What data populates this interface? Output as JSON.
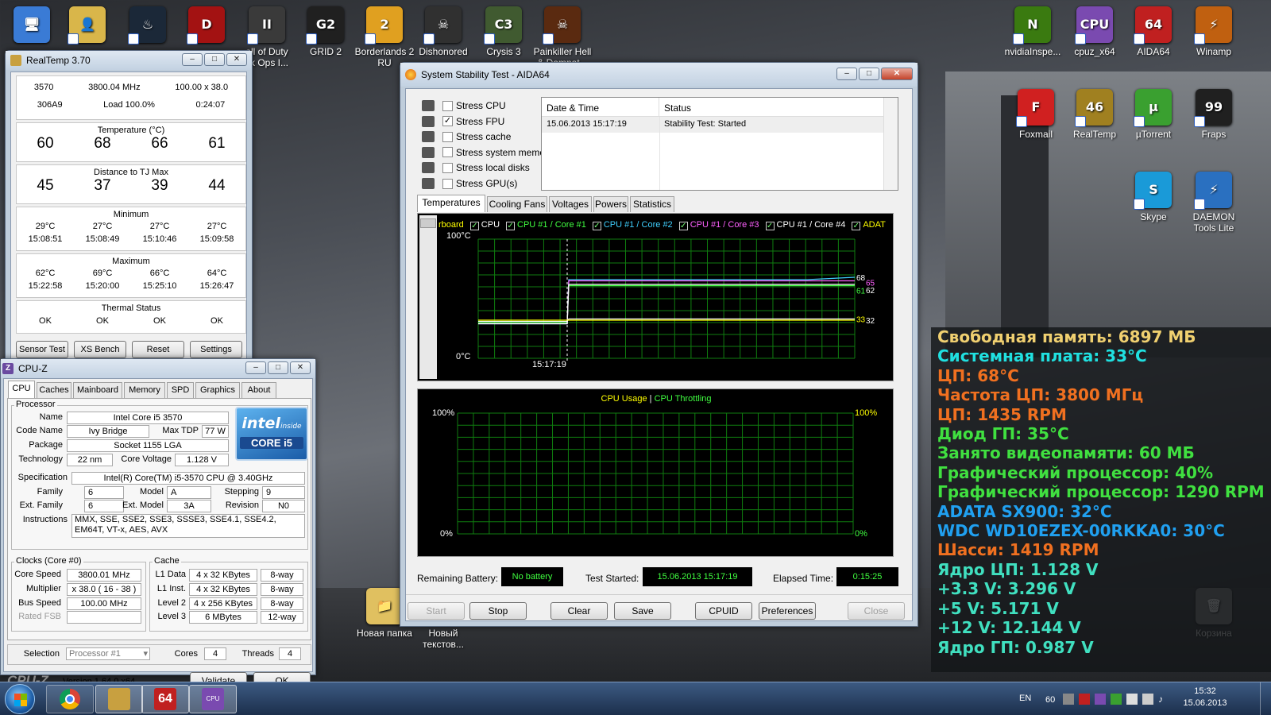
{
  "desktop": {
    "icons": [
      {
        "label": "",
        "color": "#3a7bd5",
        "glyph": "🖥"
      },
      {
        "label": "",
        "color": "#d9b64a",
        "glyph": "👤"
      },
      {
        "label": "",
        "color": "#1b2838",
        "glyph": "♨"
      },
      {
        "label": "",
        "color": "#a31212",
        "glyph": "D"
      },
      {
        "label": "all of Duty",
        "label2": "ck Ops I...",
        "color": "#3a3a3a",
        "glyph": "II"
      },
      {
        "label": "GRID 2",
        "color": "#202020",
        "glyph": "G2"
      },
      {
        "label": "Borderlands 2",
        "label2": "RU",
        "color": "#e0a020",
        "glyph": "2"
      },
      {
        "label": "Dishonored",
        "color": "#303030",
        "glyph": "☠"
      },
      {
        "label": "Crysis 3",
        "color": "#405a30",
        "glyph": "C3"
      },
      {
        "label": "Painkiller Hell",
        "label2": "& Damnat...",
        "color": "#5a2a10",
        "glyph": "☠"
      },
      {
        "label": "nvidiaInspe...",
        "color": "#3a7a10",
        "glyph": "N"
      },
      {
        "label": "cpuz_x64",
        "color": "#7a4ab0",
        "glyph": "CPU"
      },
      {
        "label": "AIDA64",
        "color": "#c02020",
        "glyph": "64"
      },
      {
        "label": "Winamp",
        "color": "#c06010",
        "glyph": "⚡"
      },
      {
        "label": "Foxmail",
        "color": "#d02020",
        "glyph": "F"
      },
      {
        "label": "RealTemp",
        "color": "#a08020",
        "glyph": "46"
      },
      {
        "label": "µTorrent",
        "color": "#3aa030",
        "glyph": "µ"
      },
      {
        "label": "Fraps",
        "color": "#202020",
        "glyph": "99"
      },
      {
        "label": "Skype",
        "color": "#1a9ad8",
        "glyph": "S"
      },
      {
        "label": "DAEMON",
        "label2": "Tools Lite",
        "color": "#2a70c0",
        "glyph": "⚡"
      },
      {
        "label": "Новая папка",
        "color": "#e0c060",
        "glyph": "📁"
      },
      {
        "label": "Новый",
        "label2": "текстов...",
        "color": "#d0d0d0",
        "glyph": "📄"
      },
      {
        "label": "Корзина",
        "color": "#8a8a8a",
        "glyph": "🗑"
      }
    ]
  },
  "realtemp": {
    "title": "RealTemp 3.70",
    "info": [
      "3570",
      "3800.04 MHz",
      "100.00 x 38.0",
      "306A9",
      "Load 100.0%",
      "0:24:07"
    ],
    "temp_label": "Temperature (°C)",
    "temps": [
      "60",
      "68",
      "66",
      "61"
    ],
    "dist_label": "Distance to TJ Max",
    "dists": [
      "45",
      "37",
      "39",
      "44"
    ],
    "min_label": "Minimum",
    "min_vals": [
      "29°C",
      "27°C",
      "27°C",
      "27°C"
    ],
    "min_times": [
      "15:08:51",
      "15:08:49",
      "15:10:46",
      "15:09:58"
    ],
    "max_label": "Maximum",
    "max_vals": [
      "62°C",
      "69°C",
      "66°C",
      "64°C"
    ],
    "max_times": [
      "15:22:58",
      "15:20:00",
      "15:25:10",
      "15:26:47"
    ],
    "thermal_label": "Thermal Status",
    "thermal": [
      "OK",
      "OK",
      "OK",
      "OK"
    ],
    "buttons": [
      "Sensor Test",
      "XS Bench",
      "Reset",
      "Settings"
    ]
  },
  "cpuz": {
    "title": "CPU-Z",
    "tabs": [
      "CPU",
      "Caches",
      "Mainboard",
      "Memory",
      "SPD",
      "Graphics",
      "About"
    ],
    "processor_label": "Processor",
    "name_l": "Name",
    "name": "Intel Core i5 3570",
    "codename_l": "Code Name",
    "codename": "Ivy Bridge",
    "tdp_l": "Max TDP",
    "tdp": "77 W",
    "package_l": "Package",
    "package": "Socket 1155 LGA",
    "tech_l": "Technology",
    "tech": "22 nm",
    "voltage_l": "Core Voltage",
    "voltage": "1.128 V",
    "spec_l": "Specification",
    "spec": "Intel(R) Core(TM) i5-3570 CPU @ 3.40GHz",
    "family_l": "Family",
    "family": "6",
    "model_l": "Model",
    "model": "A",
    "stepping_l": "Stepping",
    "stepping": "9",
    "extfamily_l": "Ext. Family",
    "extfamily": "6",
    "extmodel_l": "Ext. Model",
    "extmodel": "3A",
    "revision_l": "Revision",
    "revision": "N0",
    "instr_l": "Instructions",
    "instr": "MMX, SSE, SSE2, SSE3, SSSE3, SSE4.1, SSE4.2, EM64T, VT-x, AES, AVX",
    "logo_inside": "inside",
    "logo_core": "CORE i5",
    "clocks_label": "Clocks (Core #0)",
    "corespeed_l": "Core Speed",
    "corespeed": "3800.01 MHz",
    "mult_l": "Multiplier",
    "mult": "x 38.0 ( 16 - 38 )",
    "bus_l": "Bus Speed",
    "bus": "100.00 MHz",
    "fsb_l": "Rated FSB",
    "fsb": "",
    "cache_label": "Cache",
    "l1d_l": "L1 Data",
    "l1d": "4 x 32 KBytes",
    "l1d_w": "8-way",
    "l1i_l": "L1 Inst.",
    "l1i": "4 x 32 KBytes",
    "l1i_w": "8-way",
    "l2_l": "Level 2",
    "l2": "4 x 256 KBytes",
    "l2_w": "8-way",
    "l3_l": "Level 3",
    "l3": "6 MBytes",
    "l3_w": "12-way",
    "selection_l": "Selection",
    "selection": "Processor #1",
    "cores_l": "Cores",
    "cores": "4",
    "threads_l": "Threads",
    "threads": "4",
    "brand": "CPU-Z",
    "version": "Version 1.64.0.x64",
    "validate": "Validate",
    "ok": "OK"
  },
  "aida": {
    "title": "System Stability Test - AIDA64",
    "stress": [
      {
        "label": "Stress CPU",
        "checked": false
      },
      {
        "label": "Stress FPU",
        "checked": true
      },
      {
        "label": "Stress cache",
        "checked": false
      },
      {
        "label": "Stress system memory",
        "checked": false
      },
      {
        "label": "Stress local disks",
        "checked": false
      },
      {
        "label": "Stress GPU(s)",
        "checked": false
      }
    ],
    "log_cols": [
      "Date & Time",
      "Status"
    ],
    "log_rows": [
      [
        "15.06.2013 15:17:19",
        "Stability Test: Started"
      ]
    ],
    "tabs": [
      "Temperatures",
      "Cooling Fans",
      "Voltages",
      "Powers",
      "Statistics"
    ],
    "temp_legend": [
      "rboard",
      "CPU",
      "CPU #1 / Core #1",
      "CPU #1 / Core #2",
      "CPU #1 / Core #3",
      "CPU #1 / Core #4",
      "ADAT"
    ],
    "temp_legend_colors": [
      "#ffff00",
      "#ffffff",
      "#40ff40",
      "#40d0ff",
      "#ff60ff",
      "#ffffff",
      "#ffff00"
    ],
    "temp_top": "100°C",
    "temp_bottom": "0°C",
    "temp_time": "15:17:19",
    "temp_end_labels": [
      "68",
      "65",
      "62",
      "61",
      "33",
      "32"
    ],
    "usage_legend1": "CPU Usage",
    "usage_sep": "|",
    "usage_legend2": "CPU Throttling",
    "usage_top_l": "100%",
    "usage_bottom_l": "0%",
    "usage_top_r": "100%",
    "usage_bottom_r": "0%",
    "battery_l": "Remaining Battery:",
    "battery": "No battery",
    "started_l": "Test Started:",
    "started": "15.06.2013 15:17:19",
    "elapsed_l": "Elapsed Time:",
    "elapsed": "0:15:25",
    "buttons": {
      "start": "Start",
      "stop": "Stop",
      "clear": "Clear",
      "save": "Save",
      "cpuid": "CPUID",
      "prefs": "Preferences",
      "close": "Close"
    }
  },
  "chart_data": [
    {
      "type": "line",
      "title": "",
      "ylim": [
        0,
        100
      ],
      "y_top_label": "100°C",
      "y_bottom_label": "0°C",
      "x_labels": [
        "15:17:19"
      ],
      "series": [
        {
          "name": "CPU #1 / Core #1",
          "color": "#40ff40",
          "values": [
            30,
            30,
            30,
            61,
            61,
            61,
            61,
            61,
            61,
            61
          ]
        },
        {
          "name": "CPU #1 / Core #2",
          "color": "#40d0ff",
          "values": [
            29,
            29,
            29,
            66,
            66,
            66,
            66,
            66,
            66,
            68
          ]
        },
        {
          "name": "CPU #1 / Core #3",
          "color": "#ff60ff",
          "values": [
            29,
            29,
            29,
            65,
            65,
            65,
            65,
            65,
            65,
            65
          ]
        },
        {
          "name": "CPU #1 / Core #4",
          "color": "#ffffff",
          "values": [
            29,
            29,
            29,
            62,
            62,
            62,
            62,
            62,
            62,
            62
          ]
        },
        {
          "name": "CPU",
          "color": "#ffffff",
          "values": [
            31,
            31,
            31,
            33,
            33,
            33,
            33,
            33,
            33,
            33
          ]
        },
        {
          "name": "ADAT",
          "color": "#ffff00",
          "values": [
            32,
            32,
            32,
            32,
            32,
            32,
            32,
            32,
            32,
            32
          ]
        }
      ]
    },
    {
      "type": "line",
      "title": "",
      "ylim": [
        0,
        100
      ],
      "series": [
        {
          "name": "CPU Usage",
          "color": "#ffff00",
          "values": []
        },
        {
          "name": "CPU Throttling",
          "color": "#40ff40",
          "values": []
        }
      ]
    }
  ],
  "sensors": [
    {
      "text": "Свободная память: 6897 МБ",
      "color": "#f0d070"
    },
    {
      "text": "Системная плата: 33°C",
      "color": "#20e0e0"
    },
    {
      "text": "ЦП: 68°C",
      "color": "#f07020"
    },
    {
      "text": "Частота ЦП: 3800 МГц",
      "color": "#f07020"
    },
    {
      "text": "ЦП: 1435 RPM",
      "color": "#f07020"
    },
    {
      "text": "Диод ГП: 35°C",
      "color": "#40e040"
    },
    {
      "text": "Занято видеопамяти: 60 МБ",
      "color": "#40e040"
    },
    {
      "text": "Графический процессор: 40%",
      "color": "#40e040"
    },
    {
      "text": "Графический процессор: 1290 RPM",
      "color": "#40e040"
    },
    {
      "text": "ADATA SX900: 32°C",
      "color": "#20a0f0"
    },
    {
      "text": "WDC WD10EZEX-00RKKA0: 30°C",
      "color": "#20a0f0"
    },
    {
      "text": "Шасси: 1419 RPM",
      "color": "#f07020"
    },
    {
      "text": "Ядро ЦП: 1.128 V",
      "color": "#40e0c0"
    },
    {
      "text": "+3.3 V: 3.296 V",
      "color": "#40e0c0"
    },
    {
      "text": "+5 V: 5.171 V",
      "color": "#40e0c0"
    },
    {
      "text": "+12 V: 12.144 V",
      "color": "#40e0c0"
    },
    {
      "text": "Ядро ГП: 0.987 V",
      "color": "#40e0c0"
    }
  ],
  "taskbar": {
    "lang": "EN",
    "tray_num": "60",
    "time": "15:32",
    "date": "15.06.2013"
  }
}
